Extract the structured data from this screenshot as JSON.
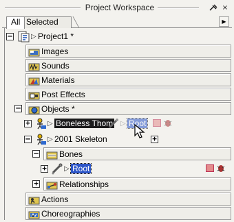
{
  "window": {
    "title": "Project Workspace",
    "pin_icon": "pin-icon",
    "close_label": "×"
  },
  "tabs": [
    {
      "label": "All",
      "active": true
    },
    {
      "label": "Selected",
      "active": false
    }
  ],
  "tab_scroll_icon": "arrow-right-icon",
  "tree": {
    "project": {
      "label": "Project1 *",
      "icon": "project-file-icon"
    },
    "images": {
      "label": "Images",
      "icon": "images-folder-icon"
    },
    "sounds": {
      "label": "Sounds",
      "icon": "sounds-folder-icon"
    },
    "materials": {
      "label": "Materials",
      "icon": "materials-folder-icon"
    },
    "post_effects": {
      "label": "Post Effects",
      "icon": "post-effects-folder-icon"
    },
    "objects": {
      "label": "Objects *",
      "icon": "objects-folder-icon"
    },
    "boneless": {
      "label": "Boneless Thom",
      "icon": "model-figure-icon"
    },
    "drag_ghost": {
      "label": "Root",
      "icon": "bone-icon"
    },
    "skeleton": {
      "label": "2001 Skeleton",
      "icon": "model-figure-icon"
    },
    "bones": {
      "label": "Bones",
      "icon": "bones-folder-icon"
    },
    "root": {
      "label": "Root",
      "icon": "bone-icon"
    },
    "relationships": {
      "label": "Relationships",
      "icon": "relationships-folder-icon"
    },
    "actions": {
      "label": "Actions",
      "icon": "actions-folder-icon"
    },
    "choreographies": {
      "label": "Choreographies",
      "icon": "choreographies-folder-icon"
    }
  },
  "colors": {
    "selection_black": "#1b1b1b",
    "selection_blue": "#2d56c8",
    "color_swatch": "#e48c8c"
  }
}
